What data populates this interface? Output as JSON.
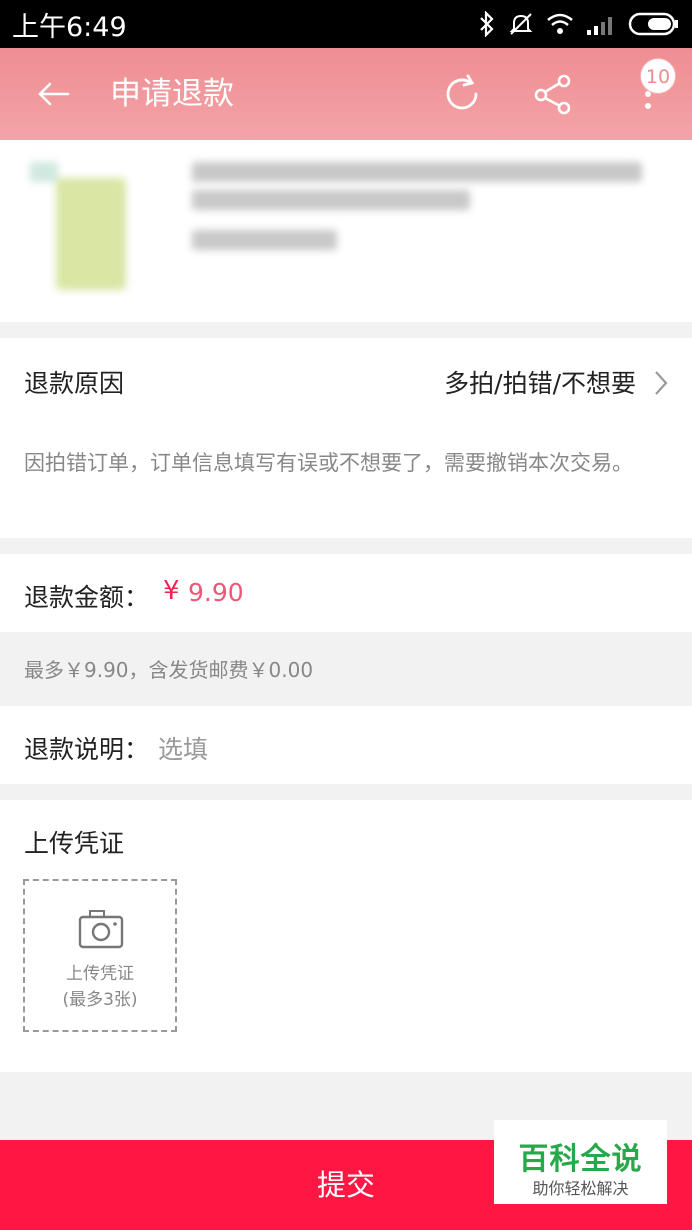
{
  "status_bar": {
    "time": "上午6:49",
    "icons": [
      "bluetooth-icon",
      "mute-icon",
      "wifi-icon",
      "signal-icon",
      "battery-icon"
    ]
  },
  "app_bar": {
    "title": "申请退款",
    "badge_count": "10",
    "background": "#f29a9e"
  },
  "refund_reason": {
    "label": "退款原因",
    "value": "多拍/拍错/不想要",
    "description": "因拍错订单，订单信息填写有误或不想要了，需要撤销本次交易。"
  },
  "refund_amount": {
    "label": "退款金额：",
    "currency": "¥",
    "value": "9.90",
    "accent": "#ee2553"
  },
  "max_note": "最多￥9.90，含发货邮费￥0.00",
  "refund_memo": {
    "label": "退款说明：",
    "placeholder": "选填"
  },
  "upload": {
    "label": "上传凭证",
    "box_label_line1": "上传凭证",
    "box_label_line2": "(最多3张)"
  },
  "submit_label": "提交",
  "watermark": {
    "title": "百科全说",
    "subtitle": "助你轻松解决"
  }
}
